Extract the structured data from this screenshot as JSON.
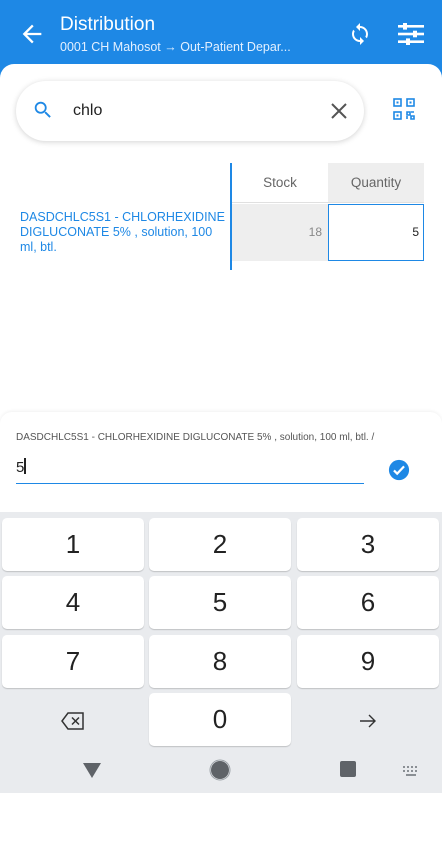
{
  "appbar": {
    "title": "Distribution",
    "subtitle_from": "0001 CH Mahosot",
    "subtitle_arrow": "→",
    "subtitle_to": "Out-Patient Depar...",
    "color": "#1e88e5"
  },
  "search": {
    "value": "chlo"
  },
  "table": {
    "headers": {
      "stock": "Stock",
      "quantity": "Quantity"
    },
    "rows": [
      {
        "name": "DASDCHLC5S1 - CHLORHEXIDINE DIGLUCONATE 5% , solution, 100 ml, btl.",
        "stock": "18",
        "quantity": "5"
      }
    ]
  },
  "entry": {
    "description": "DASDCHLC5S1 - CHLORHEXIDINE DIGLUCONATE 5% , solution, 100 ml, btl. /",
    "value": "5"
  },
  "keyboard": {
    "row1": [
      "1",
      "2",
      "3"
    ],
    "row2": [
      "4",
      "5",
      "6"
    ],
    "row3": [
      "7",
      "8",
      "9"
    ],
    "zero": "0"
  },
  "icons": [
    "back-arrow-icon",
    "sync-icon",
    "filter-icon",
    "search-icon",
    "clear-icon",
    "qr-scan-icon",
    "check-circle-icon",
    "backspace-icon",
    "arrow-right-icon"
  ]
}
